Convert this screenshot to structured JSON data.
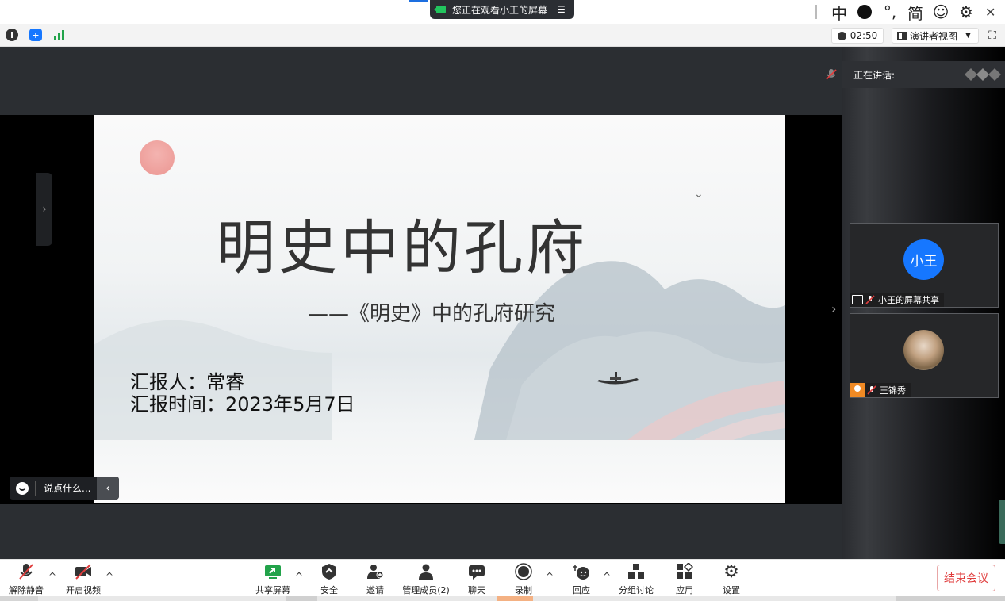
{
  "ime": {
    "mode": "中",
    "punct": "°,",
    "script": "简"
  },
  "banner": {
    "text": "您正在观看小王的屏幕"
  },
  "status": {
    "timer": "02:50",
    "view_label": "演讲者视图"
  },
  "slide": {
    "title": "明史中的孔府",
    "subtitle": "——《明史》中的孔府研究",
    "reporter": "汇报人：常睿",
    "report_time": "汇报时间：2023年5月7日"
  },
  "chat": {
    "placeholder": "说点什么..."
  },
  "panel": {
    "speaking_label": "正在讲话:",
    "participants": [
      {
        "name": "小王的屏幕共享",
        "avatar_text": "小王"
      },
      {
        "name": "王锦秀"
      }
    ]
  },
  "toolbar": {
    "unmute": "解除静音",
    "video": "开启视频",
    "share": "共享屏幕",
    "security": "安全",
    "invite": "邀请",
    "members": "管理成员(2)",
    "chat": "聊天",
    "record": "录制",
    "react": "回应",
    "breakout": "分组讨论",
    "apps": "应用",
    "settings": "设置",
    "end": "结束会议"
  },
  "colors": {
    "accent": "#1677ff",
    "end": "#e03c3c",
    "share": "#22c55e"
  }
}
